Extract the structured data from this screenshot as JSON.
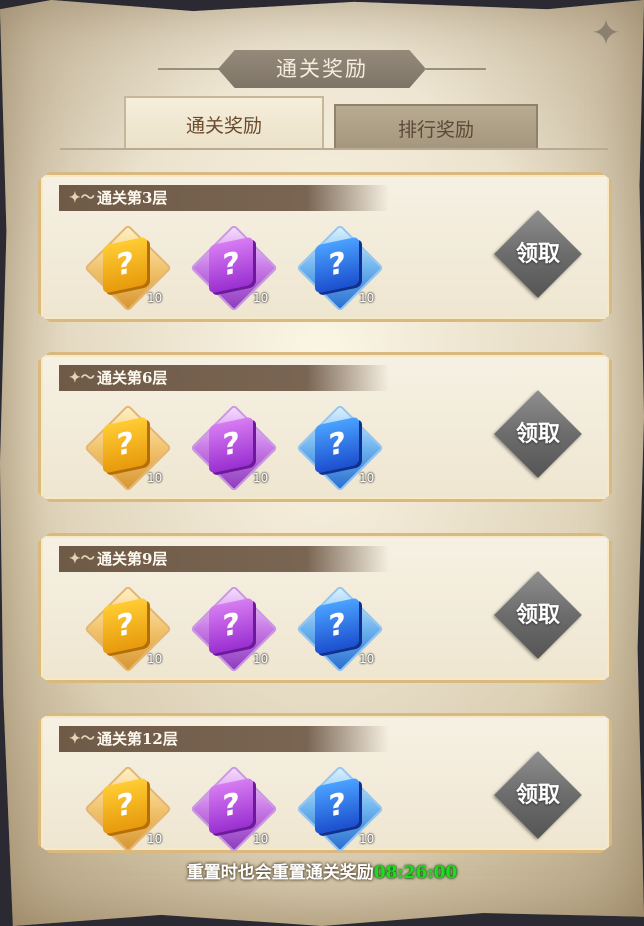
{
  "header": {
    "title": "通关奖励"
  },
  "tabs": [
    {
      "label": "通关奖励",
      "active": true
    },
    {
      "label": "排行奖励",
      "active": false
    }
  ],
  "rewards": [
    {
      "floor_label": "通关第3层",
      "items": [
        {
          "rarity": "gold",
          "icon": "?",
          "quantity": "10"
        },
        {
          "rarity": "purple",
          "icon": "?",
          "quantity": "10"
        },
        {
          "rarity": "blue",
          "icon": "?",
          "quantity": "10"
        }
      ],
      "claim_label": "领取"
    },
    {
      "floor_label": "通关第6层",
      "items": [
        {
          "rarity": "gold",
          "icon": "?",
          "quantity": "10"
        },
        {
          "rarity": "purple",
          "icon": "?",
          "quantity": "10"
        },
        {
          "rarity": "blue",
          "icon": "?",
          "quantity": "10"
        }
      ],
      "claim_label": "领取"
    },
    {
      "floor_label": "通关第9层",
      "items": [
        {
          "rarity": "gold",
          "icon": "?",
          "quantity": "10"
        },
        {
          "rarity": "purple",
          "icon": "?",
          "quantity": "10"
        },
        {
          "rarity": "blue",
          "icon": "?",
          "quantity": "10"
        }
      ],
      "claim_label": "领取"
    },
    {
      "floor_label": "通关第12层",
      "items": [
        {
          "rarity": "gold",
          "icon": "?",
          "quantity": "10"
        },
        {
          "rarity": "purple",
          "icon": "?",
          "quantity": "10"
        },
        {
          "rarity": "blue",
          "icon": "?",
          "quantity": "10"
        }
      ],
      "claim_label": "领取"
    }
  ],
  "footer": {
    "reset_text": "重置时也会重置通关奖励",
    "timer": "08:26:00"
  },
  "colors": {
    "timer": "#19e01b",
    "band": "#6f5a48",
    "claim_button": "#6c6c6c"
  },
  "icons": {
    "corner": "compass-star-icon",
    "band": "flourish-icon"
  }
}
